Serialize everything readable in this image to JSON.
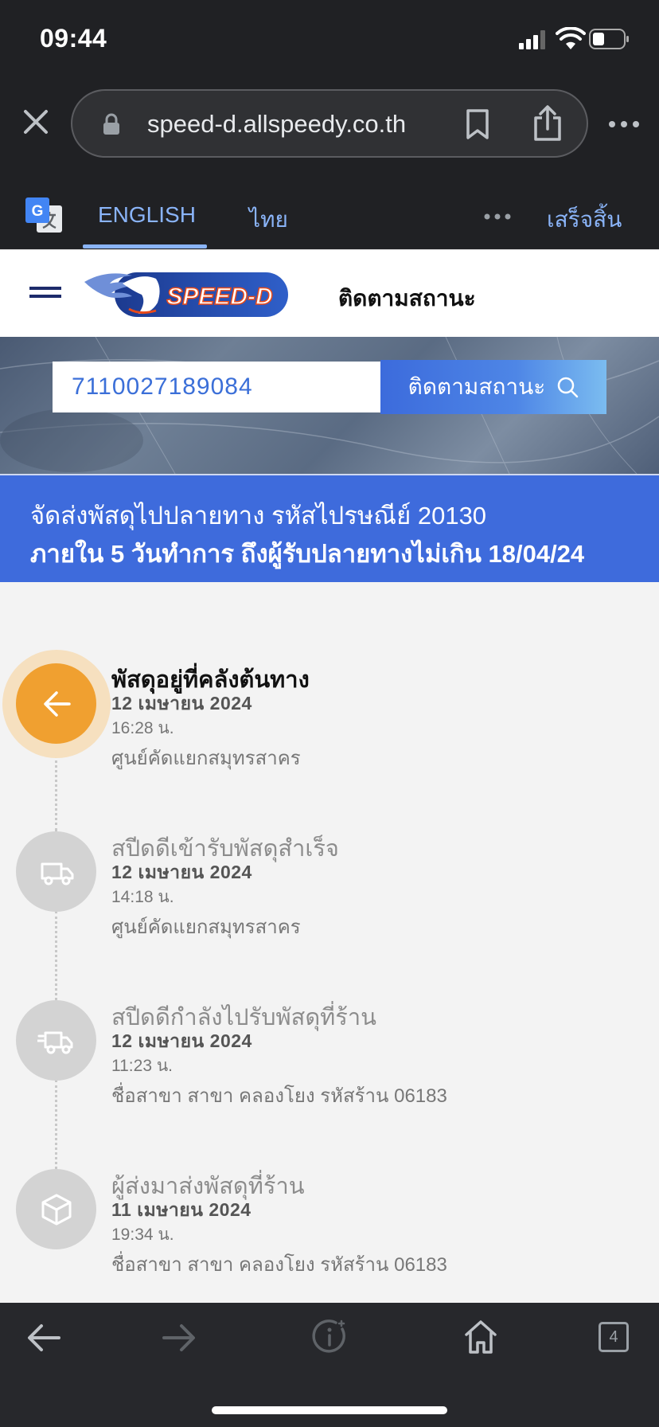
{
  "status_bar": {
    "time": "09:44"
  },
  "browser": {
    "url": "speed-d.allspeedy.co.th",
    "tab_count": "4"
  },
  "translate_bar": {
    "lang_english": "ENGLISH",
    "lang_thai": "ไทย",
    "done_label": "เสร็จสิ้น"
  },
  "site": {
    "header_title": "ติดตามสถานะ",
    "logo_text": "SPEED-D",
    "search": {
      "value": "7110027189084",
      "button_label": "ติดตามสถานะ"
    },
    "banner": {
      "line1": "จัดส่งพัสดุไปปลายทาง รหัสไปรษณีย์ 20130",
      "line2": "ภายใน 5 วันทำการ ถึงผู้รับปลายทางไม่เกิน 18/04/24"
    }
  },
  "timeline": [
    {
      "title": "พัสดุอยู่ที่คลังต้นทาง",
      "date": "12 เมษายน 2024",
      "time": "16:28 น.",
      "place": "ศูนย์คัดแยกสมุทรสาคร",
      "icon": "arrow-left-icon",
      "active": true
    },
    {
      "title": "สปีดดีเข้ารับพัสดุสำเร็จ",
      "date": "12 เมษายน 2024",
      "time": "14:18 น.",
      "place": "ศูนย์คัดแยกสมุทรสาคร",
      "icon": "truck-icon",
      "active": false
    },
    {
      "title": "สปีดดีกำลังไปรับพัสดุที่ร้าน",
      "date": "12 เมษายน 2024",
      "time": "11:23 น.",
      "place": "ชื่อสาขา สาขา คลองโยง รหัสร้าน 06183",
      "icon": "fast-truck-icon",
      "active": false
    },
    {
      "title": "ผู้ส่งมาส่งพัสดุที่ร้าน",
      "date": "11 เมษายน 2024",
      "time": "19:34 น.",
      "place": "ชื่อสาขา สาขา คลองโยง รหัสร้าน 06183",
      "icon": "box-icon",
      "active": false
    }
  ],
  "colors": {
    "accent_blue": "#3e6bdc",
    "active_orange": "#f0a030",
    "chrome_dark": "#202124"
  }
}
